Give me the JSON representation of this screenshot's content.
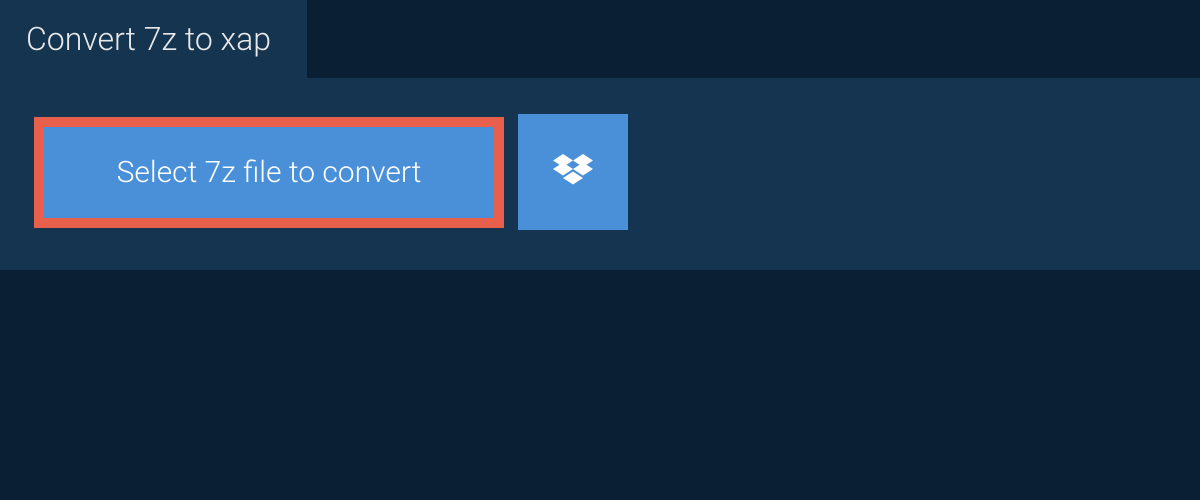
{
  "tab": {
    "title": "Convert 7z to xap"
  },
  "actions": {
    "select_file_label": "Select 7z file to convert",
    "dropbox_icon_name": "dropbox"
  },
  "colors": {
    "page_bg": "#0a1f33",
    "panel_bg": "#153450",
    "button_bg": "#4a90d9",
    "highlight_border": "#e8604c",
    "text_light": "#e8e8e8",
    "text_white": "#ffffff"
  }
}
